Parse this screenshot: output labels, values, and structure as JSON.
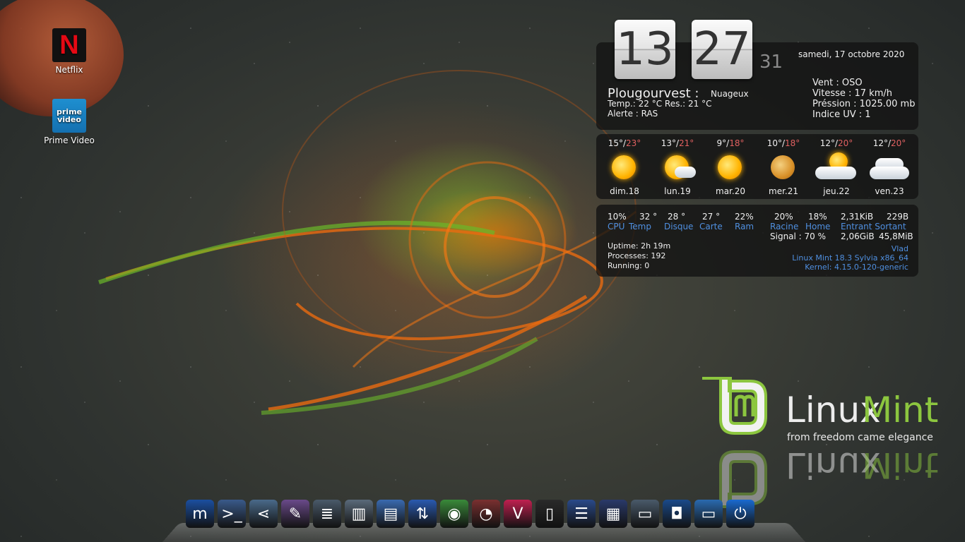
{
  "desktop": {
    "icons": [
      {
        "label": "Netflix",
        "glyph": "N",
        "icon": "netflix-icon"
      },
      {
        "label": "Prime Video",
        "glyph_top": "prime",
        "glyph_bottom": "video",
        "icon": "prime-video-icon"
      }
    ]
  },
  "clock": {
    "hours": "13",
    "minutes": "27",
    "seconds": "31",
    "date": "samedi, 17 octobre 2020"
  },
  "weather": {
    "location": "Plougourvest :",
    "condition": "Nuageux",
    "temp_line": "Temp.: 22 °C   Res.: 21 °C",
    "alert": "Alerte : RAS",
    "wind": "Vent : OSO",
    "speed": "Vitesse : 17 km/h",
    "pressure": "Préssion : 1025.00 mb",
    "uv": "Indice UV : 1",
    "forecast": [
      {
        "min": "15°/",
        "max": "23°",
        "day": "dim.18",
        "icon": "sunny-icon"
      },
      {
        "min": "13°/",
        "max": "21°",
        "day": "lun.19",
        "icon": "sun-cloud-icon"
      },
      {
        "min": "9°/",
        "max": "18°",
        "day": "mar.20",
        "icon": "sunny-icon"
      },
      {
        "min": "10°/",
        "max": "18°",
        "day": "mer.21",
        "icon": "hazy-sun-icon"
      },
      {
        "min": "12°/",
        "max": "20°",
        "day": "jeu.22",
        "icon": "partly-cloudy-icon"
      },
      {
        "min": "12°/",
        "max": "20°",
        "day": "ven.23",
        "icon": "cloudy-icon"
      }
    ]
  },
  "system": {
    "cpu_val": "10%",
    "cpu_label": "CPU",
    "temp_val": "32 °",
    "temp_label": "Temp",
    "disk_val": "28 °",
    "disk_label": "Disque",
    "card_val": "27 °",
    "card_label": "Carte",
    "ram_val": "22%",
    "ram_label": "Ram",
    "root_val": "20%",
    "root_label": "Racine",
    "home_val": "18%",
    "home_label": "Home",
    "net_in": "2,31KiB",
    "net_out": "229B",
    "net_label": "Entrant Sortant",
    "net_total_in": "2,06GiB",
    "net_total_out": "45,8MiB",
    "signal": "Signal : 70 %",
    "uptime": "Uptime: 2h 19m",
    "processes": "Processes: 192",
    "running": "Running: 0",
    "user": "Vlad",
    "distro": "Linux Mint 18.3 Sylvia   x86_64",
    "kernel": "Kernel: 4.15.0-120-generic"
  },
  "branding": {
    "word1": "Linux",
    "word2": "Mint",
    "tagline": "from freedom came elegance"
  },
  "colors": {
    "mint_green": "#8cc63f",
    "accent_blue": "#4f8fe0",
    "warm_red": "#e06060"
  },
  "dock": {
    "items": [
      {
        "name": "mint-menu-icon",
        "glyph": "m"
      },
      {
        "name": "terminal-icon",
        "glyph": ">_"
      },
      {
        "name": "share-icon",
        "glyph": "⋖"
      },
      {
        "name": "text-editor-icon",
        "glyph": "✎"
      },
      {
        "name": "server-icon",
        "glyph": "≣"
      },
      {
        "name": "files-icon",
        "glyph": "▥"
      },
      {
        "name": "disk-utility-icon",
        "glyph": "▤"
      },
      {
        "name": "network-icon",
        "glyph": "⇅"
      },
      {
        "name": "chrome-icon",
        "glyph": "◉"
      },
      {
        "name": "app-icon",
        "glyph": "◔"
      },
      {
        "name": "vivaldi-icon",
        "glyph": "V"
      },
      {
        "name": "phone-icon",
        "glyph": "▯"
      },
      {
        "name": "notes-icon",
        "glyph": "☰"
      },
      {
        "name": "calculator-icon",
        "glyph": "▦"
      },
      {
        "name": "system-monitor-icon",
        "glyph": "▭"
      },
      {
        "name": "camera-icon",
        "glyph": "◘"
      },
      {
        "name": "display-icon",
        "glyph": "▭"
      },
      {
        "name": "power-icon",
        "glyph": "⏻"
      }
    ]
  }
}
